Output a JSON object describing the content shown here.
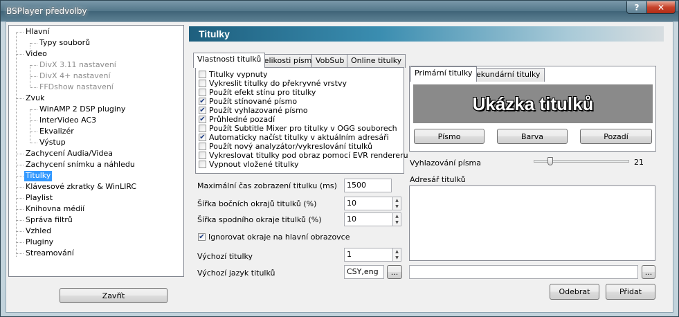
{
  "window": {
    "title": "BSPlayer předvolby",
    "help_label": "?",
    "close_label": "✕"
  },
  "tree": {
    "items": [
      {
        "label": "Hlavní"
      },
      {
        "label": "Typy souborů"
      },
      {
        "label": "Video"
      },
      {
        "label": "DivX 3.11 nastavení"
      },
      {
        "label": "DivX 4+ nastavení"
      },
      {
        "label": "FFDshow nastavení"
      },
      {
        "label": "Zvuk"
      },
      {
        "label": "WinAMP 2 DSP pluginy"
      },
      {
        "label": "InterVideo AC3"
      },
      {
        "label": "Ekvalizér"
      },
      {
        "label": "Výstup"
      },
      {
        "label": "Zachycení Audia/Videa"
      },
      {
        "label": "Zachycení snímku a náhledu"
      },
      {
        "label": "Titulky"
      },
      {
        "label": "Klávesové zkratky & WinLIRC"
      },
      {
        "label": "Playlist"
      },
      {
        "label": "Knihovna médií"
      },
      {
        "label": "Správa filtrů"
      },
      {
        "label": "Vzhled"
      },
      {
        "label": "Pluginy"
      },
      {
        "label": "Streamování"
      }
    ]
  },
  "close_button": "Zavřít",
  "header": {
    "title": "Titulky"
  },
  "tabs": [
    "Vlastnosti titulků",
    "Velikosti písma",
    "VobSub",
    "Online titulky"
  ],
  "options": [
    {
      "label": "Titulky vypnuty",
      "checked": false
    },
    {
      "label": "Vykreslit titulky do překryvné vrstvy",
      "checked": false
    },
    {
      "label": "Použít efekt stínu pro titulky",
      "checked": false
    },
    {
      "label": "Použít stínované písmo",
      "checked": true
    },
    {
      "label": "Použít vyhlazované písmo",
      "checked": true
    },
    {
      "label": "Průhledné pozadí",
      "checked": true
    },
    {
      "label": "Použít Subtitle Mixer pro titulky v OGG souborech",
      "checked": false
    },
    {
      "label": "Automaticky načíst titulky v aktuálním adresáři",
      "checked": true
    },
    {
      "label": "Použít nový analyzátor/vykreslování titulků",
      "checked": false
    },
    {
      "label": "Vykreslovat titulky pod obraz pomocí EVR rendereru",
      "checked": false
    },
    {
      "label": "Vypnout vložené titulky",
      "checked": false
    }
  ],
  "fields": {
    "max_time_label": "Maximální čas zobrazení titulku (ms)",
    "max_time_value": "1500",
    "side_margin_label": "Šířka bočních okrajů titulků (%)",
    "side_margin_value": "10",
    "bottom_margin_label": "Šířka spodního okraje titulků (%)",
    "bottom_margin_value": "10",
    "ignore_margins_label": "Ignorovat okraje na hlavní obrazovce",
    "default_subs_label": "Výchozí titulky",
    "default_subs_value": "1",
    "default_lang_label": "Výchozí jazyk titulků",
    "default_lang_value": "CSY,eng",
    "browse_label": "..."
  },
  "preview": {
    "tabs": [
      "Primární titulky",
      "Sekundární titulky"
    ],
    "sample_text": "Ukázka titulků",
    "font_button": "Písmo",
    "color_button": "Barva",
    "background_button": "Pozadí"
  },
  "smoothing": {
    "label": "Vyhlazování písma",
    "value": "21",
    "level": 0.15
  },
  "subs_dir": {
    "label": "Adresář titulků",
    "path_value": "",
    "browse_label": "...",
    "remove_button": "Odebrat",
    "add_button": "Přidat"
  }
}
